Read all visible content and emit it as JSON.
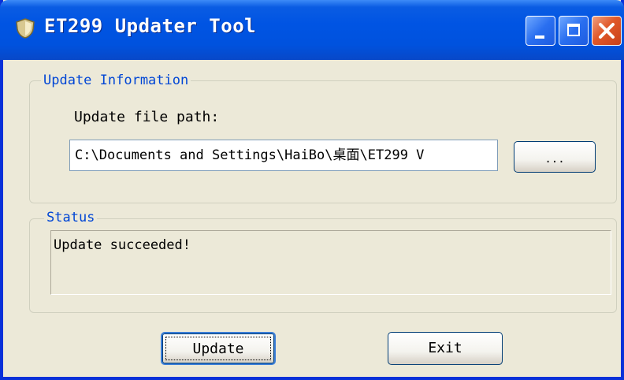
{
  "window": {
    "title": "ET299 Updater Tool",
    "app_icon": "shield-icon",
    "controls": {
      "minimize_icon": "minimize-icon",
      "maximize_icon": "maximize-icon",
      "close_icon": "close-icon"
    }
  },
  "update_info": {
    "legend": "Update Information",
    "path_label": "Update file path:",
    "path_value": "C:\\Documents and Settings\\HaiBo\\桌面\\ET299 V",
    "browse_label": "..."
  },
  "status": {
    "legend": "Status",
    "message": "Update succeeded!"
  },
  "buttons": {
    "update_label": "Update",
    "exit_label": "Exit"
  },
  "colors": {
    "titlebar": "#0054e3",
    "legend_text": "#0046d5",
    "close_button": "#e0582a",
    "window_face": "#ece9d8"
  }
}
